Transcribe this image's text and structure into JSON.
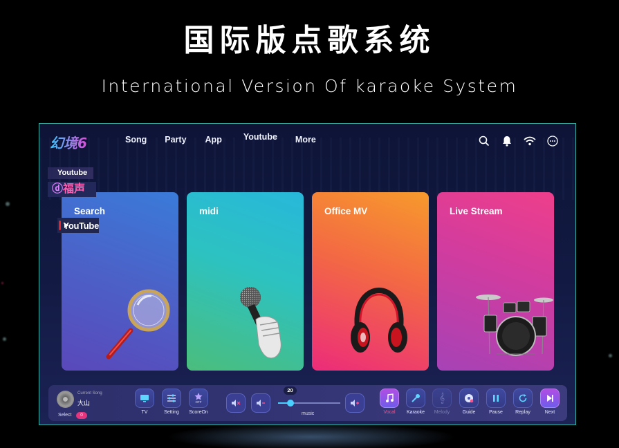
{
  "header": {
    "title_cn": "国际版点歌系统",
    "subtitle": "International Version Of karaoke System"
  },
  "app": {
    "logo": "幻境6",
    "nav": [
      "Song",
      "Party",
      "App",
      "Youtube",
      "More"
    ],
    "active_nav": "Youtube",
    "top_icons": [
      "search-icon",
      "bell-icon",
      "wifi-icon",
      "more-icon"
    ]
  },
  "overlay": {
    "youtube_tag": "Youtube",
    "brand": "福声",
    "youtube_logo_text": "YouTube"
  },
  "cards": [
    {
      "title": "Search",
      "icon": "magnifier-icon"
    },
    {
      "title": "midi",
      "icon": "microphone-icon"
    },
    {
      "title": "Office MV",
      "icon": "headphones-icon"
    },
    {
      "title": "Live Stream",
      "icon": "drum-kit-icon"
    }
  ],
  "player": {
    "current_song_label": "Current Song",
    "current_song": "大山",
    "select_label": "Select",
    "select_count": "0",
    "volume": "20",
    "music_label": "music",
    "controls": [
      {
        "label": "TV",
        "icon": "tv-icon"
      },
      {
        "label": "Setting",
        "icon": "sliders-icon"
      },
      {
        "label": "ScoreOn",
        "icon": "star-icon",
        "sub": "OFF"
      },
      {
        "label": "Vocal",
        "icon": "music-note-icon",
        "state": "active"
      },
      {
        "label": "Karaoke",
        "icon": "microphone-icon"
      },
      {
        "label": "Melody",
        "icon": "treble-clef-icon",
        "state": "disabled"
      },
      {
        "label": "Guide",
        "icon": "guide-disc-icon"
      },
      {
        "label": "Pause",
        "icon": "pause-icon"
      },
      {
        "label": "Replay",
        "icon": "replay-icon"
      },
      {
        "label": "Next",
        "icon": "next-icon"
      }
    ],
    "volume_level": 0.2
  },
  "colors": {
    "accent_pink": "#ff4f8a",
    "screen_border": "#3bb0a6"
  }
}
